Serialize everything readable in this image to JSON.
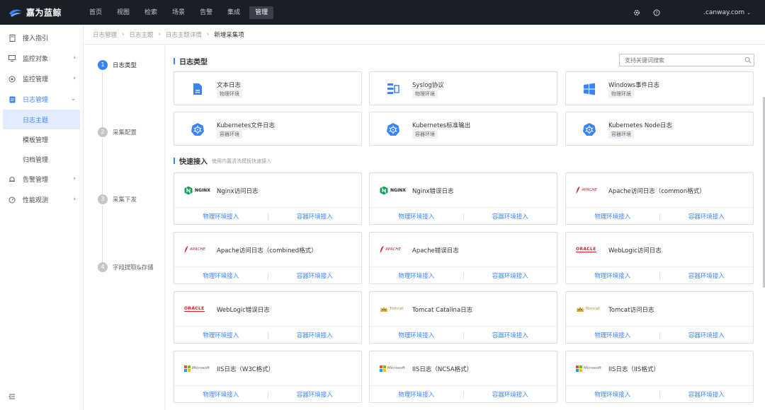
{
  "app": {
    "name": "嘉为蓝鲸"
  },
  "topnav": [
    {
      "label": "首页",
      "active": false
    },
    {
      "label": "视图",
      "active": false
    },
    {
      "label": "检索",
      "active": false
    },
    {
      "label": "场景",
      "active": false
    },
    {
      "label": "告警",
      "active": false
    },
    {
      "label": "集成",
      "active": false
    },
    {
      "label": "管理",
      "active": true
    }
  ],
  "user": {
    "name": ".canway.com"
  },
  "sidebar": {
    "items": [
      {
        "label": "接入指引"
      },
      {
        "label": "监控对象"
      },
      {
        "label": "监控管理"
      },
      {
        "label": "日志管理"
      },
      {
        "label": "告警管理"
      },
      {
        "label": "性能观测"
      }
    ],
    "log_sub": [
      {
        "label": "日志主题"
      },
      {
        "label": "模板管理"
      },
      {
        "label": "归档管理"
      }
    ]
  },
  "breadcrumb": [
    "日志管理",
    "日志主题",
    "日志主题详情",
    "新增采集项"
  ],
  "steps": [
    {
      "num": "1",
      "label": "日志类型"
    },
    {
      "num": "2",
      "label": "采集配置"
    },
    {
      "num": "3",
      "label": "采集下发"
    },
    {
      "num": "4",
      "label": "字段提取&存储"
    }
  ],
  "log_type": {
    "title": "日志类型",
    "search_placeholder": "支持关键词搜索",
    "cards": [
      {
        "name": "文本日志",
        "tag": "物理环境",
        "icon": "file-text-icon"
      },
      {
        "name": "Syslog协议",
        "tag": "物理环境",
        "icon": "syslog-icon"
      },
      {
        "name": "Windows事件日志",
        "tag": "物理环境",
        "icon": "windows-icon"
      },
      {
        "name": "Kubernetes文件日志",
        "tag": "容器环境",
        "icon": "kubernetes-icon"
      },
      {
        "name": "Kubernetes标准输出",
        "tag": "容器环境",
        "icon": "kubernetes-icon"
      },
      {
        "name": "Kubernetes Node日志",
        "tag": "容器环境",
        "icon": "kubernetes-icon"
      }
    ]
  },
  "quick": {
    "title": "快速接入",
    "subtitle": "使用内置清洗模板快速接入",
    "physical_label": "物理环境接入",
    "container_label": "容器环境接入",
    "cards": [
      {
        "name": "Nginx访问日志",
        "logo": "nginx-logo",
        "logo_text": "NGINX"
      },
      {
        "name": "Nginx错误日志",
        "logo": "nginx-logo",
        "logo_text": "NGINX"
      },
      {
        "name": "Apache访问日志（common格式）",
        "logo": "apache-logo",
        "logo_text": "APACHE"
      },
      {
        "name": "Apache访问日志（combined格式）",
        "logo": "apache-logo",
        "logo_text": "APACHE"
      },
      {
        "name": "Apache错误日志",
        "logo": "apache-logo",
        "logo_text": "APACHE"
      },
      {
        "name": "WebLogic访问日志",
        "logo": "oracle-logo",
        "logo_text": "ORACLE"
      },
      {
        "name": "WebLogic错误日志",
        "logo": "oracle-logo",
        "logo_text": "ORACLE"
      },
      {
        "name": "Tomcat Catalina日志",
        "logo": "tomcat-logo",
        "logo_text": "Tomcat"
      },
      {
        "name": "Tomcat访问日志",
        "logo": "tomcat-logo",
        "logo_text": "Tomcat"
      },
      {
        "name": "IIS日志（W3C格式）",
        "logo": "microsoft-logo",
        "logo_text": "Microsoft"
      },
      {
        "name": "IIS日志（NCSA格式）",
        "logo": "microsoft-logo",
        "logo_text": "Microsoft"
      },
      {
        "name": "IIS日志（IIS格式）",
        "logo": "microsoft-logo",
        "logo_text": "Microsoft"
      }
    ]
  },
  "colors": {
    "accent": "#3a84ff",
    "topbar": "#1a1e26"
  }
}
